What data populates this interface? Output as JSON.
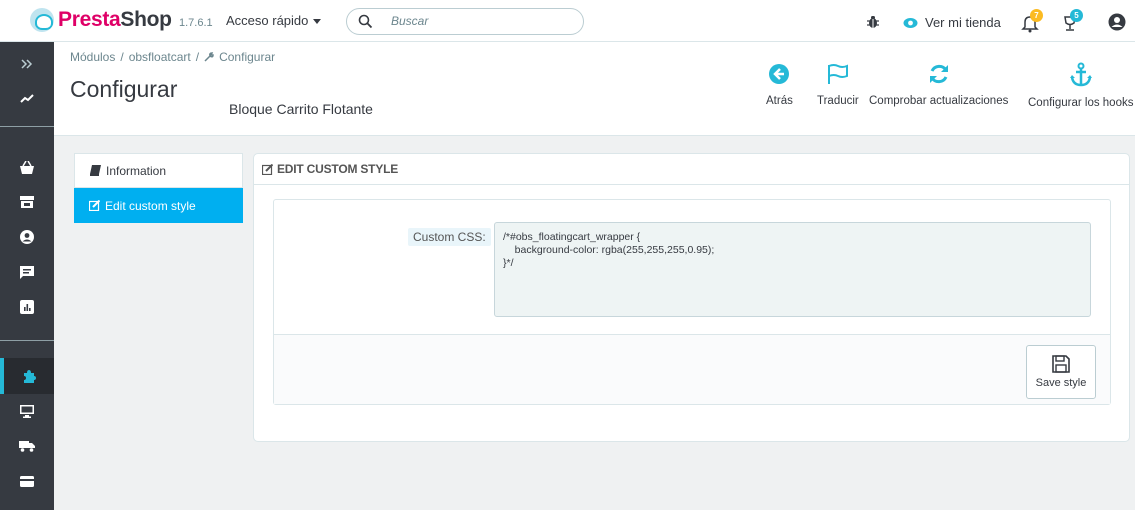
{
  "topbar": {
    "brand_a": "Presta",
    "brand_b": "Shop",
    "version": "1.7.6.1",
    "quick_access": "Acceso rápido",
    "search_placeholder": "Buscar",
    "view_shop": "Ver mi tienda",
    "notif_badge_1": "7",
    "notif_badge_2": "5"
  },
  "sidebar": {
    "items": [
      "collapse-icon",
      "stats-icon",
      "orders-icon",
      "catalog-icon",
      "customers-icon",
      "messages-icon",
      "reports-icon",
      "modules-icon",
      "design-icon",
      "shipping-icon",
      "payment-icon"
    ]
  },
  "header": {
    "breadcrumb": [
      "Módulos",
      "obsfloatcart",
      "Configurar"
    ],
    "breadcrumb_sep": "/",
    "title": "Configurar",
    "subtitle": "Bloque Carrito Flotante",
    "toolbar": {
      "back": "Atrás",
      "translate": "Traducir",
      "check_updates": "Comprobar actualizaciones",
      "hooks": "Configurar los hooks"
    }
  },
  "tabs": {
    "information": "Information",
    "edit_style": "Edit custom style"
  },
  "panel": {
    "heading": "EDIT CUSTOM STYLE",
    "css_label": "Custom CSS:",
    "css_value": "/*#obs_floatingcart_wrapper {\n    background-color: rgba(255,255,255,0.95);\n}*/",
    "save_label": "Save style"
  },
  "colors": {
    "accent": "#25b9d7",
    "brand": "#df0067",
    "tab_active": "#00aff0",
    "sidebar": "#363a41"
  }
}
